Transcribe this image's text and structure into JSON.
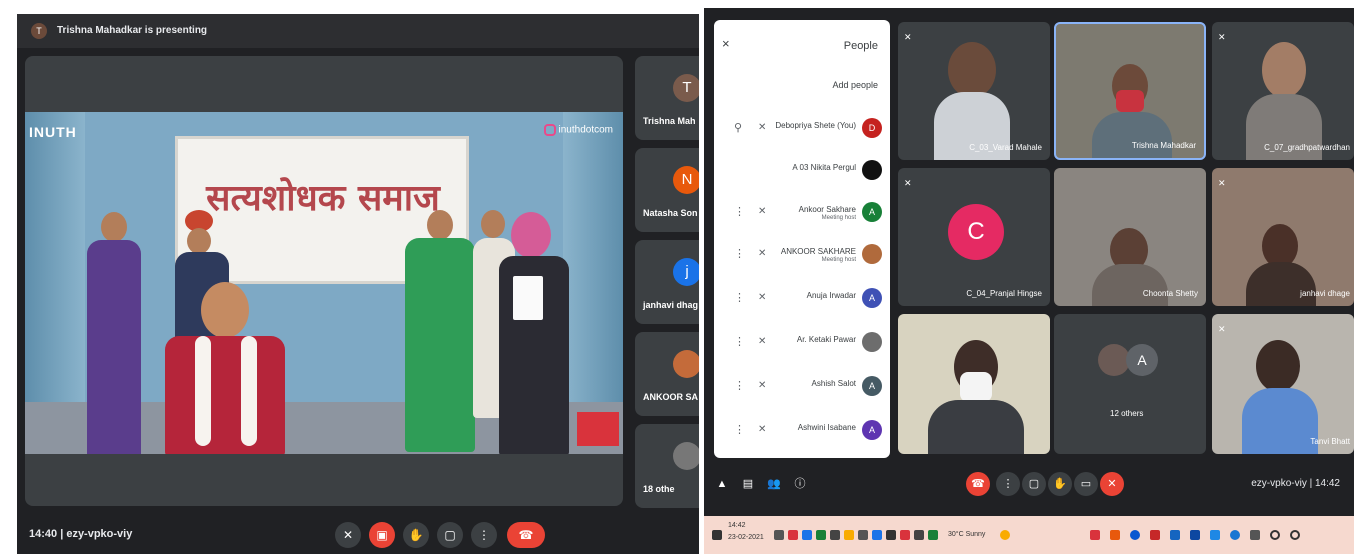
{
  "left": {
    "presenting_avatar": "T",
    "presenting_text": "Trishna Mahadkar is presenting",
    "slide": {
      "brand": "INUTH",
      "instagram": "inuthdotcom",
      "banner_text": "सत्यशोधक समाज"
    },
    "side_tiles": [
      {
        "initial": "T",
        "name": "Trishna Mah",
        "color": "#7a5b4c"
      },
      {
        "initial": "N",
        "name": "Natasha Son",
        "color": "#e8590c"
      },
      {
        "initial": "j",
        "name": "janhavi dhag",
        "color": "#1a73e8"
      },
      {
        "initial": "",
        "name": "ANKOOR SA",
        "color": "#c46b3a"
      },
      {
        "initial": "",
        "name": "18 othe",
        "color": "#777777"
      }
    ],
    "meeting_info": "14:40  |  ezy-vpko-viy",
    "controls": [
      "mic-off",
      "camera-off",
      "raise-hand",
      "present",
      "more",
      "leave"
    ]
  },
  "right": {
    "people_panel": {
      "title": "People",
      "close": "×",
      "add_people": "Add people",
      "participants": [
        {
          "initial": "D",
          "name": "Debopriya Shete (You)",
          "sub": "",
          "color": "#c5221f"
        },
        {
          "initial": "",
          "name": "A 03 Nikita Pergul",
          "sub": "",
          "color": "#111111"
        },
        {
          "initial": "A",
          "name": "Ankoor Sakhare",
          "sub": "Meeting host",
          "color": "#188038"
        },
        {
          "initial": "",
          "name": "ANKOOR SAKHARE",
          "sub": "Meeting host",
          "color": "#b06a3c"
        },
        {
          "initial": "A",
          "name": "Anuja Irwadar",
          "sub": "",
          "color": "#3f51b5"
        },
        {
          "initial": "",
          "name": "Ar. Ketaki Pawar",
          "sub": "",
          "color": "#6d6d6d"
        },
        {
          "initial": "A",
          "name": "Ashish Salot",
          "sub": "",
          "color": "#455a64"
        },
        {
          "initial": "A",
          "name": "Ashwini Isabane",
          "sub": "",
          "color": "#5e35b1"
        }
      ]
    },
    "tiles": [
      {
        "name": "C_03_Varad Mahale",
        "initial": ""
      },
      {
        "name": "Trishna Mahadkar",
        "initial": ""
      },
      {
        "name": "C_07_gradhpatwardhan",
        "initial": ""
      },
      {
        "name": "C_04_Pranjal Hingse",
        "initial": "C"
      },
      {
        "name": "Choonta Shetty",
        "initial": ""
      },
      {
        "name": "janhavi dhage",
        "initial": ""
      },
      {
        "name": "",
        "initial": ""
      },
      {
        "name": "12 others",
        "initial": "A"
      },
      {
        "name": "Tanvi Bhatt",
        "initial": ""
      }
    ],
    "meeting_info": "ezy-vpko-viy  |  14:42",
    "taskbar_time": "14:42",
    "taskbar_date": "23-02-2021",
    "taskbar_weather": "30°C Sunny"
  }
}
